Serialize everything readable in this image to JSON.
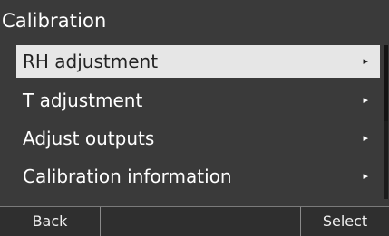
{
  "screen": {
    "title": "Calibration"
  },
  "menu": {
    "items": [
      {
        "label": "RH adjustment",
        "arrow": "▸",
        "selected": true
      },
      {
        "label": "T adjustment",
        "arrow": "▸",
        "selected": false
      },
      {
        "label": "Adjust outputs",
        "arrow": "▸",
        "selected": false
      },
      {
        "label": "Calibration information",
        "arrow": "▸",
        "selected": false
      }
    ]
  },
  "softkeys": {
    "left_label": "Back",
    "middle_label": "",
    "right_label": "Select"
  },
  "colors": {
    "background": "#3a3a3a",
    "highlight": "#e6e6e6",
    "text": "#ffffff",
    "highlight_text": "#222222"
  }
}
